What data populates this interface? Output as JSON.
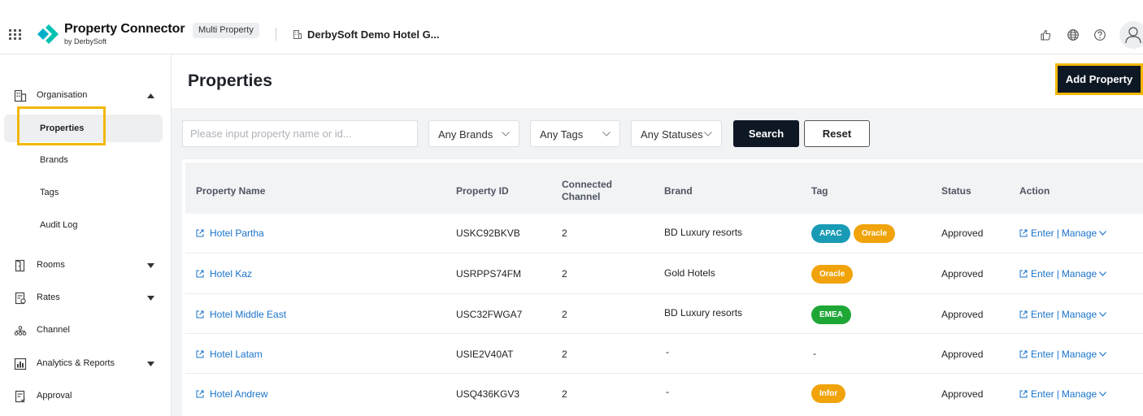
{
  "header": {
    "brand_title": "Property Connector",
    "brand_subtitle": "by DerbySoft",
    "mode_badge": "Multi Property",
    "hotel_name": "DerbySoft Demo Hotel G...",
    "icons": [
      "apps-grid-icon",
      "thumb-icon",
      "globe-icon",
      "help-icon",
      "user-icon"
    ]
  },
  "sidebar": {
    "organisation": "Organisation",
    "sub_items": [
      "Properties",
      "Brands",
      "Tags",
      "Audit Log"
    ],
    "rooms": "Rooms",
    "rates": "Rates",
    "channel": "Channel",
    "analytics": "Analytics & Reports",
    "approval": "Approval"
  },
  "main": {
    "title": "Properties",
    "add_button": "Add Property",
    "search_placeholder": "Please input property name or id...",
    "filters": {
      "brands": "Any Brands",
      "tags": "Any Tags",
      "statuses": "Any Statuses"
    },
    "search_button": "Search",
    "reset_button": "Reset"
  },
  "table": {
    "columns": [
      "Property Name",
      "Property ID",
      "Connected",
      "Channel",
      "Brand",
      "Tag",
      "Status",
      "Action"
    ],
    "rows": [
      {
        "name": "Hotel Partha",
        "id": "USKC92BKVB",
        "channel": "2",
        "brand": "BD Luxury resorts",
        "tags": [
          "APAC",
          "Oracle"
        ],
        "status": "Approved"
      },
      {
        "name": "Hotel Kaz",
        "id": "USRPPS74FM",
        "channel": "2",
        "brand": "Gold Hotels",
        "tags": [
          "Oracle"
        ],
        "status": "Approved"
      },
      {
        "name": "Hotel Middle East",
        "id": "USC32FWGA7",
        "channel": "2",
        "brand": "BD Luxury resorts",
        "tags": [
          "EMEA"
        ],
        "status": "Approved"
      },
      {
        "name": "Hotel Latam",
        "id": "USIE2V40AT",
        "channel": "2",
        "brand": "-",
        "tags": [],
        "tag_text": "-",
        "status": "Approved"
      },
      {
        "name": "Hotel Andrew",
        "id": "USQ436KGV3",
        "channel": "2",
        "brand": "-",
        "tags": [
          "Infor"
        ],
        "status": "Approved"
      }
    ],
    "action_enter": "Enter",
    "action_sep": "|",
    "action_manage": "Manage"
  },
  "colors": {
    "primary_dark": "#0e1824",
    "highlight": "#f2b705",
    "link": "#1a73c9",
    "tag_apac": "#1a9bb5",
    "tag_oracle": "#f0a30a",
    "tag_emea": "#1ea737",
    "tag_infor": "#f0a30a"
  }
}
